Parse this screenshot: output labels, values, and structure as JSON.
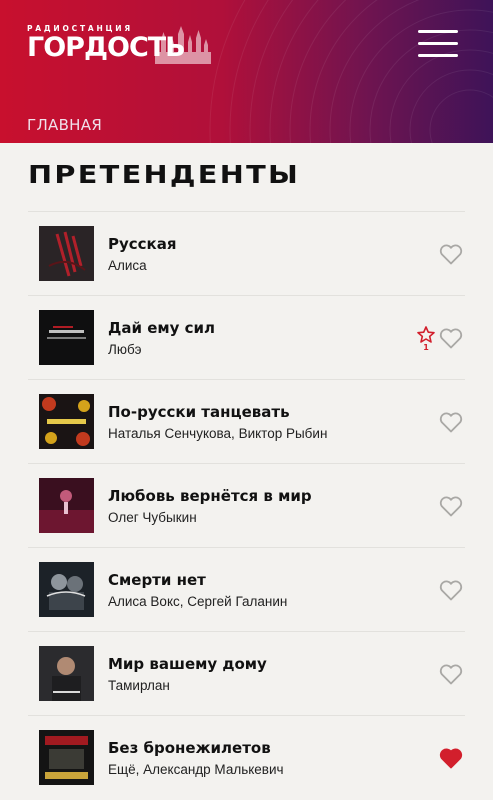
{
  "header": {
    "logo_top": "РАДИОСТАНЦИЯ",
    "logo_main": "ГОРДОСТЬ",
    "breadcrumb": "ГЛАВНАЯ",
    "colors": {
      "red": "#c8102e",
      "purple": "#3e1358"
    }
  },
  "page": {
    "title": "ПРЕТЕНДЕНТЫ"
  },
  "tracks": [
    {
      "title": "Русская",
      "artist": "Алиса",
      "liked": false
    },
    {
      "title": "Дай ему сил",
      "artist": "Любэ",
      "liked": false,
      "star_count": "1"
    },
    {
      "title": "По-русски танцевать",
      "artist": "Наталья Сенчукова, Виктор Рыбин",
      "liked": false
    },
    {
      "title": "Любовь вернётся в мир",
      "artist": "Олег Чубыкин",
      "liked": false
    },
    {
      "title": "Смерти нет",
      "artist": "Алиса Вокс, Сергей Галанин",
      "liked": false
    },
    {
      "title": "Мир вашему дому",
      "artist": "Тамирлан",
      "liked": false
    },
    {
      "title": "Без бронежилетов",
      "artist": "Ещё, Александр Малькевич",
      "liked": true
    }
  ],
  "icons": {
    "menu": "hamburger-icon",
    "like": "heart-icon",
    "vote": "star-icon"
  },
  "accent": "#d21f2c"
}
